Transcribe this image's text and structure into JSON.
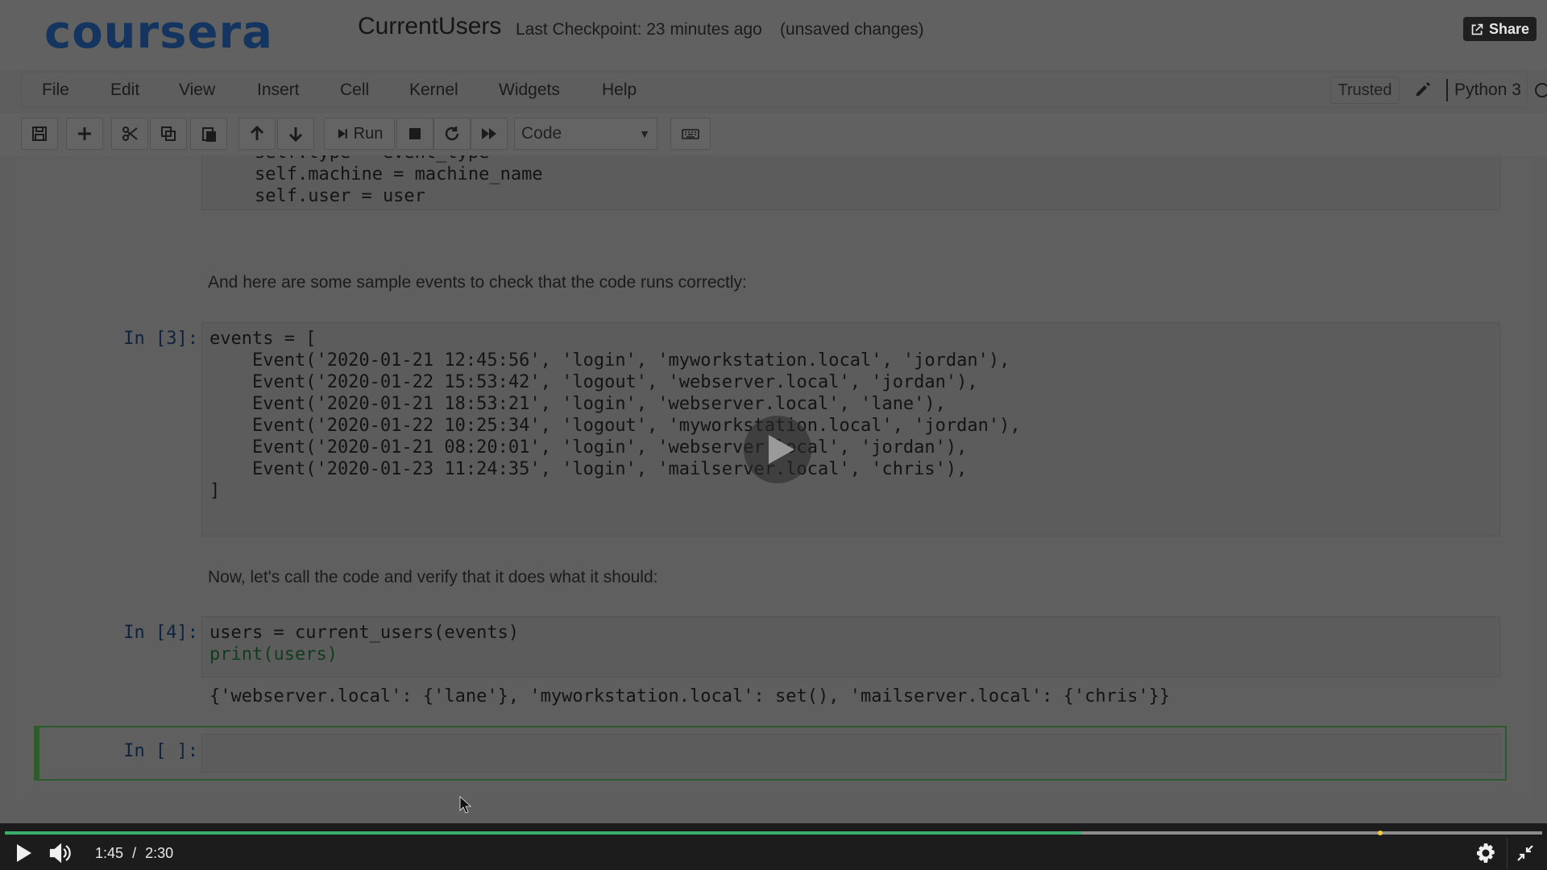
{
  "header": {
    "logo": "coursera",
    "notebook_title": "CurrentUsers",
    "checkpoint": "Last Checkpoint: 23 minutes ago",
    "unsaved": "(unsaved changes)",
    "share_label": "Share"
  },
  "menubar": {
    "items": [
      "File",
      "Edit",
      "View",
      "Insert",
      "Cell",
      "Kernel",
      "Widgets",
      "Help"
    ],
    "trusted_label": "Trusted",
    "kernel_name": "Python 3"
  },
  "toolbar": {
    "run_label": "Run",
    "cell_type": "Code"
  },
  "notebook": {
    "cell_top_lines": [
      "self.type = event_type",
      "self.machine = machine_name",
      "self.user = user"
    ],
    "markdown_1": "And here are some sample events to check that the code runs correctly:",
    "cell3": {
      "prompt": "In [3]:",
      "lines": [
        "events = [",
        "    Event('2020-01-21 12:45:56', 'login', 'myworkstation.local', 'jordan'),",
        "    Event('2020-01-22 15:53:42', 'logout', 'webserver.local', 'jordan'),",
        "    Event('2020-01-21 18:53:21', 'login', 'webserver.local', 'lane'),",
        "    Event('2020-01-22 10:25:34', 'logout', 'myworkstation.local', 'jordan'),",
        "    Event('2020-01-21 08:20:01', 'login', 'webserver.local', 'jordan'),",
        "    Event('2020-01-23 11:24:35', 'login', 'mailserver.local', 'chris'),",
        "]"
      ]
    },
    "markdown_2": "Now, let's call the code and verify that it does what it should:",
    "cell4": {
      "prompt": "In [4]:",
      "lines": [
        "users = current_users(events)",
        "print(users)"
      ],
      "output": "{'webserver.local': {'lane'}, 'myworkstation.local': set(), 'mailserver.local': {'chris'}}"
    },
    "cell5": {
      "prompt": "In [ ]:"
    }
  },
  "player": {
    "current_time": "1:45",
    "duration": "2:30",
    "time_separator": "/",
    "progress_fraction": 0.7
  },
  "colors": {
    "logo": "#13355f",
    "progress": "#3cae6c",
    "selected_cell_border": "#2c5a2c"
  }
}
